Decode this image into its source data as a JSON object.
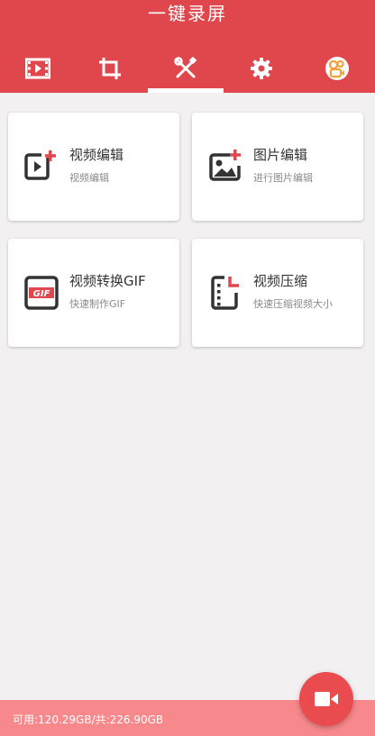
{
  "header": {
    "title": "一键录屏",
    "tabs": [
      {
        "icon": "film-icon"
      },
      {
        "icon": "crop-icon"
      },
      {
        "icon": "tools-icon",
        "active": true
      },
      {
        "icon": "gear-icon"
      },
      {
        "icon": "kuaishou-app-icon"
      }
    ]
  },
  "cards": [
    {
      "icon": "video-edit-icon",
      "title": "视频编辑",
      "subtitle": "视频编辑"
    },
    {
      "icon": "image-edit-icon",
      "title": "图片编辑",
      "subtitle": "进行图片编辑"
    },
    {
      "icon": "gif-icon",
      "title": "视频转换GIF",
      "subtitle": "快速制作GIF"
    },
    {
      "icon": "compress-icon",
      "title": "视频压缩",
      "subtitle": "快速压缩视频大小"
    }
  ],
  "footer": {
    "storage_text": "可用:120.29GB/共:226.90GB"
  },
  "fab": {
    "icon": "video-camera-icon"
  },
  "colors": {
    "primary": "#e0474c",
    "footer": "#f7888b",
    "fab": "#ea4b4f",
    "background": "#f2f0f1"
  }
}
